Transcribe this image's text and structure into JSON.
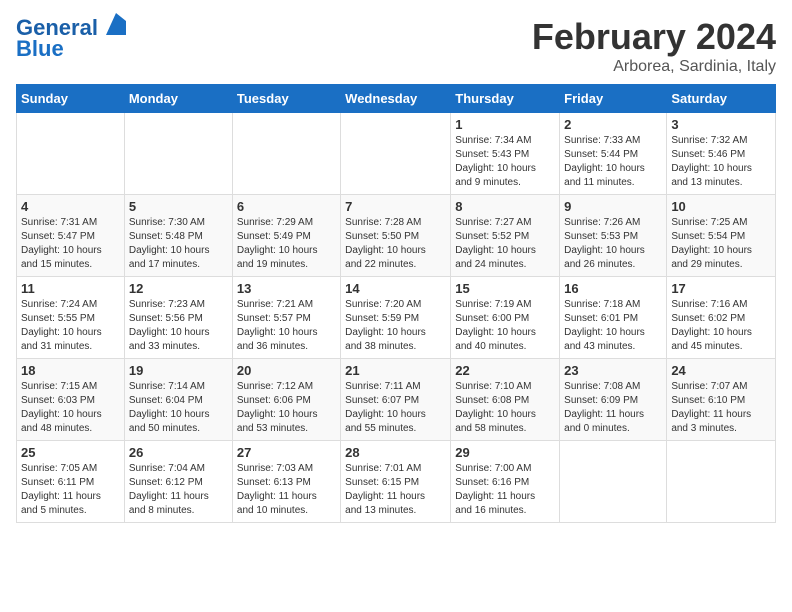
{
  "header": {
    "logo_line1": "General",
    "logo_line2": "Blue",
    "title": "February 2024",
    "subtitle": "Arborea, Sardinia, Italy"
  },
  "days_of_week": [
    "Sunday",
    "Monday",
    "Tuesday",
    "Wednesday",
    "Thursday",
    "Friday",
    "Saturday"
  ],
  "weeks": [
    [
      {
        "day": "",
        "info": ""
      },
      {
        "day": "",
        "info": ""
      },
      {
        "day": "",
        "info": ""
      },
      {
        "day": "",
        "info": ""
      },
      {
        "day": "1",
        "info": "Sunrise: 7:34 AM\nSunset: 5:43 PM\nDaylight: 10 hours\nand 9 minutes."
      },
      {
        "day": "2",
        "info": "Sunrise: 7:33 AM\nSunset: 5:44 PM\nDaylight: 10 hours\nand 11 minutes."
      },
      {
        "day": "3",
        "info": "Sunrise: 7:32 AM\nSunset: 5:46 PM\nDaylight: 10 hours\nand 13 minutes."
      }
    ],
    [
      {
        "day": "4",
        "info": "Sunrise: 7:31 AM\nSunset: 5:47 PM\nDaylight: 10 hours\nand 15 minutes."
      },
      {
        "day": "5",
        "info": "Sunrise: 7:30 AM\nSunset: 5:48 PM\nDaylight: 10 hours\nand 17 minutes."
      },
      {
        "day": "6",
        "info": "Sunrise: 7:29 AM\nSunset: 5:49 PM\nDaylight: 10 hours\nand 19 minutes."
      },
      {
        "day": "7",
        "info": "Sunrise: 7:28 AM\nSunset: 5:50 PM\nDaylight: 10 hours\nand 22 minutes."
      },
      {
        "day": "8",
        "info": "Sunrise: 7:27 AM\nSunset: 5:52 PM\nDaylight: 10 hours\nand 24 minutes."
      },
      {
        "day": "9",
        "info": "Sunrise: 7:26 AM\nSunset: 5:53 PM\nDaylight: 10 hours\nand 26 minutes."
      },
      {
        "day": "10",
        "info": "Sunrise: 7:25 AM\nSunset: 5:54 PM\nDaylight: 10 hours\nand 29 minutes."
      }
    ],
    [
      {
        "day": "11",
        "info": "Sunrise: 7:24 AM\nSunset: 5:55 PM\nDaylight: 10 hours\nand 31 minutes."
      },
      {
        "day": "12",
        "info": "Sunrise: 7:23 AM\nSunset: 5:56 PM\nDaylight: 10 hours\nand 33 minutes."
      },
      {
        "day": "13",
        "info": "Sunrise: 7:21 AM\nSunset: 5:57 PM\nDaylight: 10 hours\nand 36 minutes."
      },
      {
        "day": "14",
        "info": "Sunrise: 7:20 AM\nSunset: 5:59 PM\nDaylight: 10 hours\nand 38 minutes."
      },
      {
        "day": "15",
        "info": "Sunrise: 7:19 AM\nSunset: 6:00 PM\nDaylight: 10 hours\nand 40 minutes."
      },
      {
        "day": "16",
        "info": "Sunrise: 7:18 AM\nSunset: 6:01 PM\nDaylight: 10 hours\nand 43 minutes."
      },
      {
        "day": "17",
        "info": "Sunrise: 7:16 AM\nSunset: 6:02 PM\nDaylight: 10 hours\nand 45 minutes."
      }
    ],
    [
      {
        "day": "18",
        "info": "Sunrise: 7:15 AM\nSunset: 6:03 PM\nDaylight: 10 hours\nand 48 minutes."
      },
      {
        "day": "19",
        "info": "Sunrise: 7:14 AM\nSunset: 6:04 PM\nDaylight: 10 hours\nand 50 minutes."
      },
      {
        "day": "20",
        "info": "Sunrise: 7:12 AM\nSunset: 6:06 PM\nDaylight: 10 hours\nand 53 minutes."
      },
      {
        "day": "21",
        "info": "Sunrise: 7:11 AM\nSunset: 6:07 PM\nDaylight: 10 hours\nand 55 minutes."
      },
      {
        "day": "22",
        "info": "Sunrise: 7:10 AM\nSunset: 6:08 PM\nDaylight: 10 hours\nand 58 minutes."
      },
      {
        "day": "23",
        "info": "Sunrise: 7:08 AM\nSunset: 6:09 PM\nDaylight: 11 hours\nand 0 minutes."
      },
      {
        "day": "24",
        "info": "Sunrise: 7:07 AM\nSunset: 6:10 PM\nDaylight: 11 hours\nand 3 minutes."
      }
    ],
    [
      {
        "day": "25",
        "info": "Sunrise: 7:05 AM\nSunset: 6:11 PM\nDaylight: 11 hours\nand 5 minutes."
      },
      {
        "day": "26",
        "info": "Sunrise: 7:04 AM\nSunset: 6:12 PM\nDaylight: 11 hours\nand 8 minutes."
      },
      {
        "day": "27",
        "info": "Sunrise: 7:03 AM\nSunset: 6:13 PM\nDaylight: 11 hours\nand 10 minutes."
      },
      {
        "day": "28",
        "info": "Sunrise: 7:01 AM\nSunset: 6:15 PM\nDaylight: 11 hours\nand 13 minutes."
      },
      {
        "day": "29",
        "info": "Sunrise: 7:00 AM\nSunset: 6:16 PM\nDaylight: 11 hours\nand 16 minutes."
      },
      {
        "day": "",
        "info": ""
      },
      {
        "day": "",
        "info": ""
      }
    ]
  ]
}
